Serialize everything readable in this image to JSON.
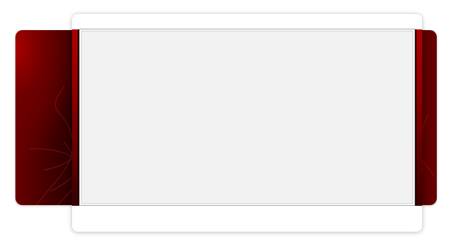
{
  "window": {
    "title": ""
  },
  "colors": {
    "accent_red": "#b00000",
    "deep_red": "#6a0000",
    "panel_bg": "#f2f2f2",
    "card_bg": "#ffffff",
    "panel_border": "#a8a8a8"
  },
  "panel": {
    "content": ""
  }
}
